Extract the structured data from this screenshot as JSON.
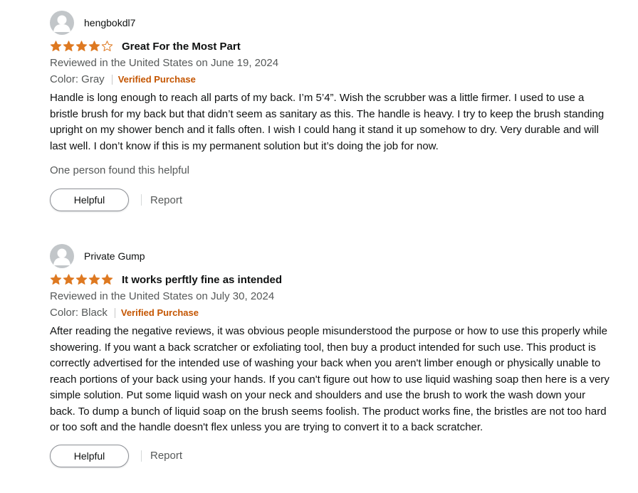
{
  "colors": {
    "star": "#de7921",
    "verified": "#c45500",
    "secondary_text": "#565959",
    "avatar": "#c2c6c9"
  },
  "reviews": [
    {
      "author": "hengbokdl7",
      "avatar_icon": "default-user-avatar-icon",
      "rating": 4,
      "rating_max": 5,
      "title": "Great For the Most Part",
      "date": "Reviewed in the United States on June 19, 2024",
      "format": "Color: Gray",
      "verified": "Verified Purchase",
      "body": "Handle is long enough to reach all parts of my back. I’m 5’4”. Wish the scrubber was a little firmer. I used to use a bristle brush for my back but that didn’t seem as sanitary as this. The handle is heavy. I try to keep the brush standing upright on my shower bench and it falls often. I wish I could hang it stand it up somehow to dry. Very durable and will last well. I don’t know if this is my permanent solution but it’s doing the job for now.",
      "helpful_count": "One person found this helpful",
      "helpful_label": "Helpful",
      "report_label": "Report"
    },
    {
      "author": "Private Gump",
      "avatar_icon": "default-user-avatar-icon",
      "rating": 5,
      "rating_max": 5,
      "title": "It works perftly fine as intended",
      "date": "Reviewed in the United States on July 30, 2024",
      "format": "Color: Black",
      "verified": "Verified Purchase",
      "body": "After reading the negative reviews, it was obvious people misunderstood the purpose or how to use this properly while showering. If you want a back scratcher or exfoliating tool, then buy a product intended for such use. This product is correctly advertised for the intended use of washing your back when you aren't limber enough or physically unable to reach portions of your back using your hands. If you can't figure out how to use liquid washing soap then here is a very simple solution. Put some liquid wash on your neck and shoulders and use the brush to work the wash down your back. To dump a bunch of liquid soap on the brush seems foolish. The product works fine, the bristles are not too hard or too soft and the handle doesn't flex unless you are trying to convert it to a back scratcher.",
      "helpful_label": "Helpful",
      "report_label": "Report"
    }
  ]
}
